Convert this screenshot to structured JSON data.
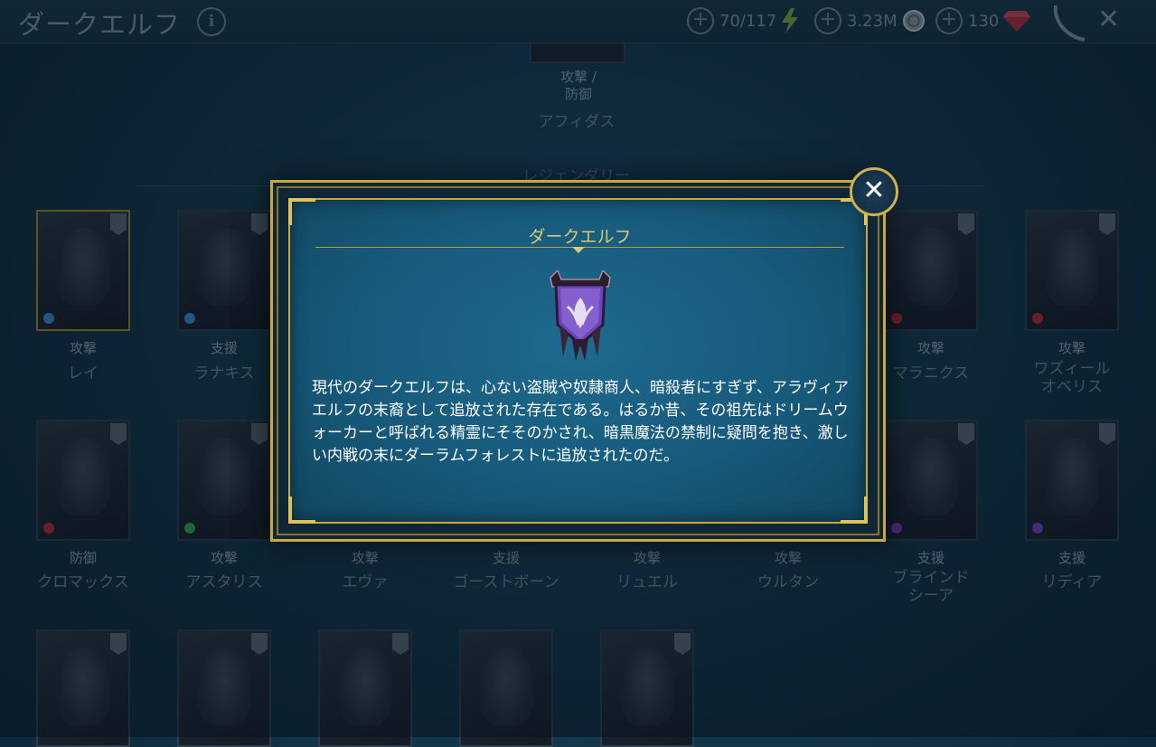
{
  "header": {
    "title": "ダークエルフ",
    "info_icon": "info-icon",
    "resources": [
      {
        "value": "70/117",
        "icon": "energy-icon"
      },
      {
        "value": "3.23M",
        "icon": "silver-icon"
      },
      {
        "value": "130",
        "icon": "gem-icon"
      }
    ],
    "close_icon": "close-icon"
  },
  "background": {
    "top_champion": {
      "role": "攻撃 /\n防御",
      "name": "アフィダス"
    },
    "section_title": "レジェンダリー",
    "row1": [
      {
        "role": "攻撃",
        "name": "レイ"
      },
      {
        "role": "支援",
        "name": "ラナキス"
      },
      {
        "role": "攻撃",
        "name": "マラニクス"
      },
      {
        "role": "攻撃",
        "name": "ワズィール\nオベリス"
      }
    ],
    "row2": [
      {
        "role": "防御",
        "name": "クロマックス"
      },
      {
        "role": "攻撃",
        "name": "アスタリス"
      },
      {
        "role": "攻撃",
        "name": "エヴァ"
      },
      {
        "role": "支援",
        "name": "ゴーストボーン"
      },
      {
        "role": "攻撃",
        "name": "リュエル"
      },
      {
        "role": "攻撃",
        "name": "ウルタン"
      },
      {
        "role": "支援",
        "name": "ブラインド\nシーア"
      },
      {
        "role": "支援",
        "name": "リディア"
      }
    ]
  },
  "modal": {
    "title": "ダークエルフ",
    "emblem_icon": "dark-elf-banner-icon",
    "description": "現代のダークエルフは、心ない盗賊や奴隷商人、暗殺者にすぎず、アラヴィアエルフの末裔として追放された存在である。はるか昔、その祖先はドリームウォーカーと呼ばれる精霊にそそのかされ、暗黒魔法の禁制に疑問を抱き、激しい内戦の末にダーラムフォレストに追放されたのだ。",
    "close_label": "✕"
  },
  "colors": {
    "accent_gold": "#c9a93d",
    "modal_blue": "#1e6a8e"
  }
}
